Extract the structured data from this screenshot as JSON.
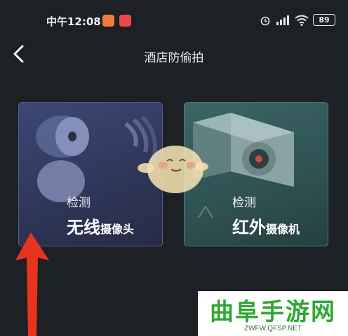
{
  "status": {
    "time": "中午12:08",
    "battery": "89"
  },
  "nav": {
    "title": "酒店防偷拍"
  },
  "cards": [
    {
      "detect": "检测",
      "main": "无线",
      "suffix": "摄像头"
    },
    {
      "detect": "检测",
      "main": "红外",
      "suffix": "摄像机"
    }
  ],
  "watermark": {
    "title": "曲阜手游网",
    "url": "ZWFW.QFSP.NET"
  },
  "colors": {
    "background": "#1d2025",
    "card_left": "#34406a",
    "card_right": "#335a5b",
    "arrow": "#e8341c",
    "watermark_green": "#2ea834"
  },
  "icons": [
    "back-chevron-icon",
    "alarm-icon",
    "signal-icon",
    "wifi-icon",
    "battery-icon",
    "wireless-camera-icon",
    "infrared-camera-icon"
  ]
}
